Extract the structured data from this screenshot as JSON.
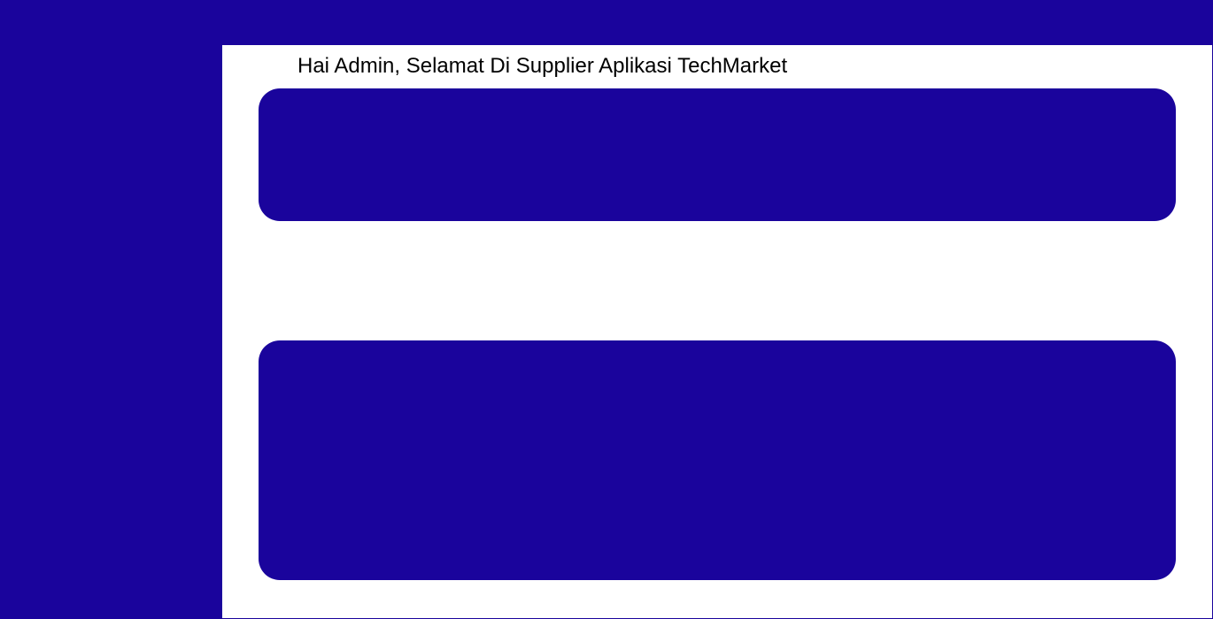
{
  "theme": {
    "primary_color": "#1a049c",
    "content_background": "#ffffff",
    "text_color": "#000000"
  },
  "main": {
    "greeting": "Hai Admin, Selamat Di Supplier Aplikasi TechMarket"
  }
}
